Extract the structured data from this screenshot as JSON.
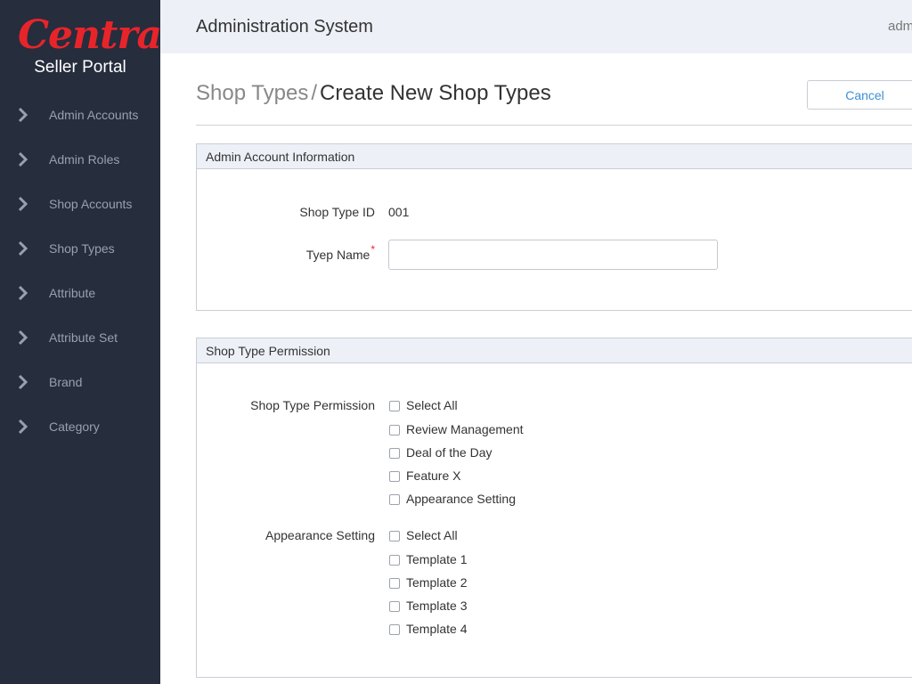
{
  "brand": {
    "logo_text": "Central",
    "subtitle": "Seller Portal",
    "accent_color": "#e8242b",
    "sidebar_bg": "#262d3d"
  },
  "sidebar": {
    "items": [
      {
        "label": "Admin Accounts",
        "icon": "chevron-right-icon"
      },
      {
        "label": "Admin Roles",
        "icon": "chevron-right-icon"
      },
      {
        "label": "Shop Accounts",
        "icon": "chevron-right-icon"
      },
      {
        "label": "Shop Types",
        "icon": "chevron-right-icon"
      },
      {
        "label": "Attribute",
        "icon": "chevron-right-icon"
      },
      {
        "label": "Attribute Set",
        "icon": "chevron-right-icon"
      },
      {
        "label": "Brand",
        "icon": "chevron-right-icon"
      },
      {
        "label": "Category",
        "icon": "chevron-right-icon"
      }
    ]
  },
  "header": {
    "title": "Administration System",
    "user": "adm"
  },
  "page": {
    "breadcrumb_parent": "Shop Types",
    "breadcrumb_separator": "/",
    "breadcrumb_current": "Create New Shop Types",
    "cancel_label": "Cancel",
    "link_color": "#3b8fd6"
  },
  "account_panel": {
    "title": "Admin Account Information",
    "id_label": "Shop Type ID",
    "id_value": "001",
    "name_label": "Tyep Name",
    "name_required_mark": "*",
    "name_value": ""
  },
  "permission_panel": {
    "title": "Shop Type Permission",
    "permission_label": "Shop Type Permission",
    "permission_options": [
      {
        "label": "Select All",
        "checked": false
      },
      {
        "label": "Review Management",
        "checked": false
      },
      {
        "label": "Deal of the Day",
        "checked": false
      },
      {
        "label": "Feature X",
        "checked": false
      },
      {
        "label": "Appearance Setting",
        "checked": false
      }
    ],
    "appearance_label": "Appearance Setting",
    "appearance_options": [
      {
        "label": "Select All",
        "checked": false
      },
      {
        "label": "Template 1",
        "checked": false
      },
      {
        "label": "Template 2",
        "checked": false
      },
      {
        "label": "Template 3",
        "checked": false
      },
      {
        "label": "Template 4",
        "checked": false
      }
    ]
  }
}
